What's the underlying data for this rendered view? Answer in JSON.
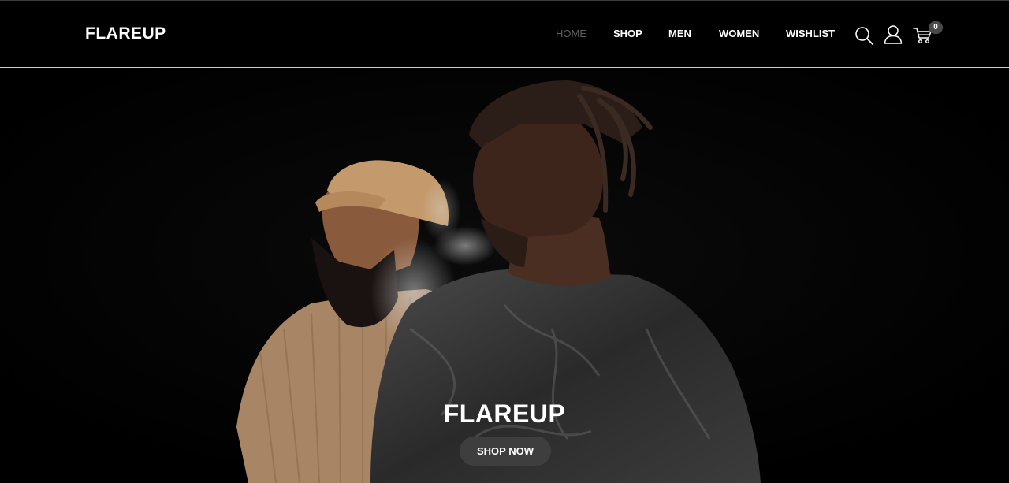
{
  "brand": {
    "logo_text": "FLAREUP"
  },
  "nav": {
    "items": [
      {
        "label": "HOME",
        "active": true
      },
      {
        "label": "SHOP"
      },
      {
        "label": "MEN"
      },
      {
        "label": "WOMEN"
      },
      {
        "label": "WISHLIST"
      }
    ]
  },
  "header_icons": {
    "search": "search-icon",
    "account": "user-icon",
    "cart": "cart-icon"
  },
  "cart": {
    "count": "0"
  },
  "hero": {
    "title": "FLAREUP",
    "button_label": "SHOP NOW"
  },
  "colors": {
    "background": "#000000",
    "active_nav": "#5f5f5f",
    "button_bg": "#3e3e3e",
    "badge_bg": "#4a4a4a"
  }
}
